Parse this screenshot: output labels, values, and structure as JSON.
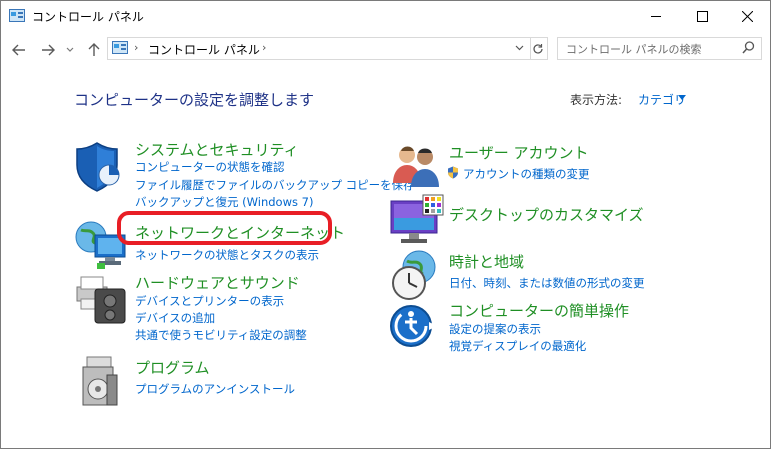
{
  "window": {
    "title": "コントロール パネル",
    "buttons": {
      "minimize": "—",
      "maximize": "☐",
      "close": "✕"
    }
  },
  "address": {
    "segments": [
      "›",
      "コントロール パネル",
      "›"
    ],
    "search_placeholder": "コントロール パネルの検索"
  },
  "main": {
    "heading": "コンピューターの設定を調整します",
    "view_by_label": "表示方法:",
    "view_by_value": "カテゴリ"
  },
  "categories": [
    {
      "id": "security",
      "icon": "shield-icon",
      "title": "システムとセキュリティ",
      "links": [
        "コンピューターの状態を確認",
        "ファイル履歴でファイルのバックアップ コピーを保存",
        "バックアップと復元 (Windows 7)"
      ]
    },
    {
      "id": "network",
      "icon": "network-globe-icon",
      "title": "ネットワークとインターネット",
      "links": [
        "ネットワークの状態とタスクの表示"
      ]
    },
    {
      "id": "hardware",
      "icon": "printer-icon",
      "title": "ハードウェアとサウンド",
      "links": [
        "デバイスとプリンターの表示",
        "デバイスの追加",
        "共通で使うモビリティ設定の調整"
      ]
    },
    {
      "id": "programs",
      "icon": "programs-icon",
      "title": "プログラム",
      "links": [
        "プログラムのアンインストール"
      ]
    },
    {
      "id": "users",
      "icon": "users-icon",
      "title": "ユーザー アカウント",
      "links": [
        "アカウントの種類の変更"
      ]
    },
    {
      "id": "desktop",
      "icon": "desktop-icon",
      "title": "デスクトップのカスタマイズ",
      "links": []
    },
    {
      "id": "clock",
      "icon": "clock-globe-icon",
      "title": "時計と地域",
      "links": [
        "日付、時刻、または数値の形式の変更"
      ]
    },
    {
      "id": "ease",
      "icon": "ease-of-access-icon",
      "title": "コンピューターの簡単操作",
      "links": [
        "設定の提案の表示",
        "視覚ディスプレイの最適化"
      ]
    }
  ],
  "colors": {
    "title_green": "#1f8f24",
    "link_blue": "#0066cc",
    "heading_blue": "#1e3287",
    "highlight_red": "#e81e25"
  }
}
